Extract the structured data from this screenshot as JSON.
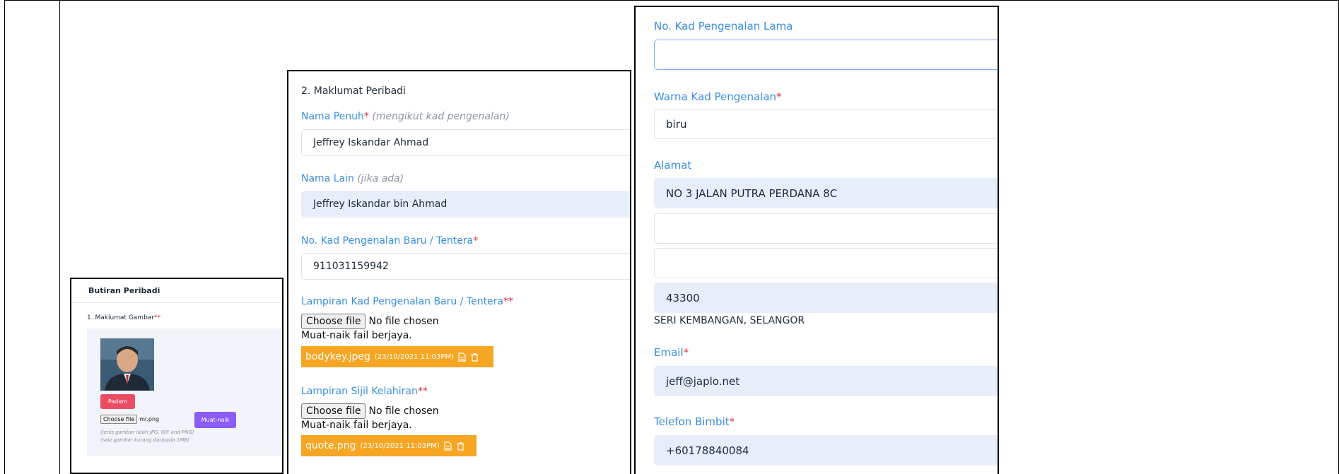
{
  "panel1": {
    "title": "Butiran Peribadi",
    "section_label": "1. Maklumat Gambar",
    "required_mark": "**",
    "delete_button": "Padam",
    "choose_file_button": "Choose file",
    "chosen_file": "ml.png",
    "upload_button": "Muat-naik",
    "note_types": "(jenis gambar ialah JPG, GIF and PNG)",
    "note_size": "(saiz gambar kurang daripada 1MB)"
  },
  "panel2": {
    "section_title": "2. Maklumat Peribadi",
    "full_name_label": "Nama Penuh",
    "full_name_req": "*",
    "full_name_hint": "(mengikut kad pengenalan)",
    "full_name_value": "Jeffrey Iskandar Ahmad",
    "other_name_label": "Nama Lain",
    "other_name_hint": "(jika ada)",
    "other_name_value": "Jeffrey Iskandar bin Ahmad",
    "new_ic_label": "No. Kad Pengenalan Baru / Tentera",
    "new_ic_req": "*",
    "new_ic_value": "911031159942",
    "ic_attach_label": "Lampiran Kad Pengenalan Baru / Tentera",
    "ic_attach_req": "**",
    "choose_file_button": "Choose file",
    "no_file_text": "No file chosen",
    "upload_success": "Muat-naik fail berjaya.",
    "ic_file_name": "bodykey.jpeg",
    "ic_file_date": "(23/10/2021 11:03PM)",
    "birth_cert_label": "Lampiran Sijil Kelahiran",
    "birth_cert_req": "**",
    "birth_file_name": "quote.png",
    "birth_file_date": "(23/10/2021 11:03PM)"
  },
  "panel3": {
    "old_ic_label": "No. Kad Pengenalan Lama",
    "old_ic_value": "",
    "ic_color_label": "Warna Kad Pengenalan",
    "ic_color_req": "*",
    "ic_color_value": "biru",
    "address_label": "Alamat",
    "address_line1": "NO 3 JALAN PUTRA PERDANA 8C",
    "address_line2": "",
    "address_line3": "",
    "postcode": "43300",
    "city_state": "SERI KEMBANGAN, SELANGOR",
    "email_label": "Email",
    "email_req": "*",
    "email_value": "jeff@japlo.net",
    "phone_label": "Telefon Bimbit",
    "phone_req": "*",
    "phone_value": "+60178840084"
  },
  "colors": {
    "label_blue": "#3a8fe0",
    "required_red": "#e2313c",
    "filled_field": "#e8eef9",
    "file_tag_orange": "#f6a623",
    "delete_red": "#ec4c63",
    "upload_purple": "#8b5cf6"
  }
}
